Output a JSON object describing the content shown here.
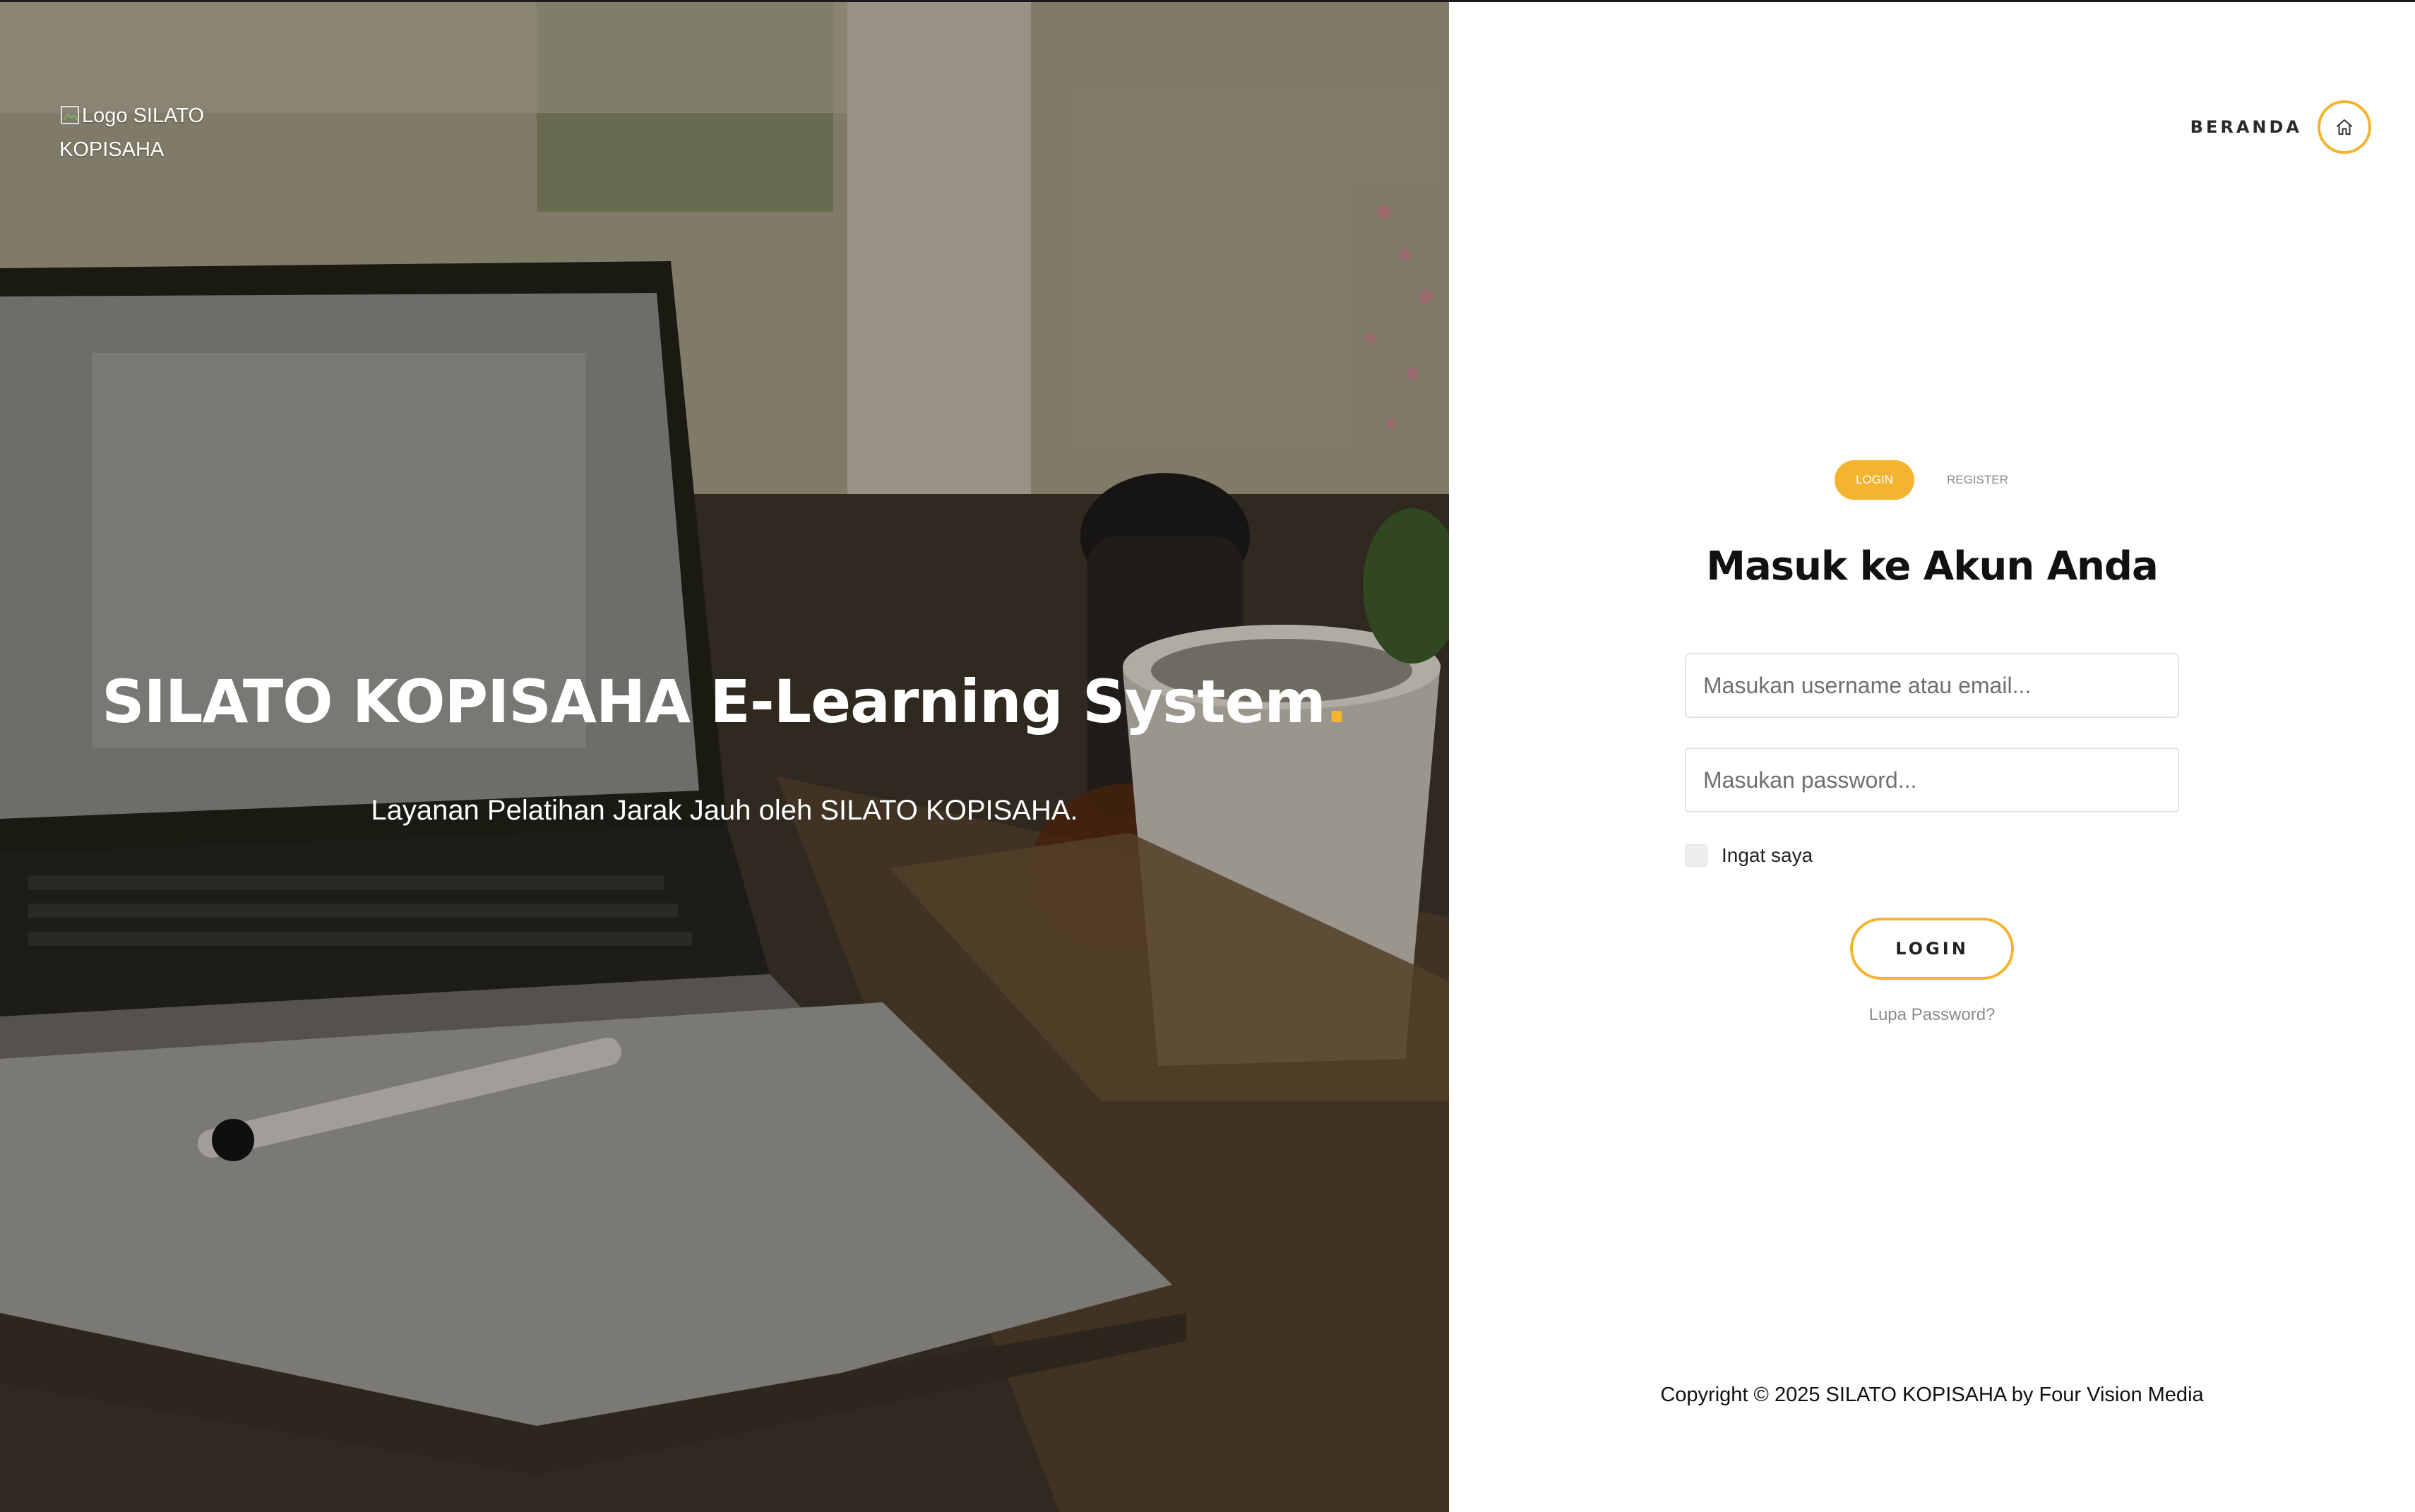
{
  "brand": {
    "logo_alt": "Logo SILATO KOPISAHA"
  },
  "hero": {
    "title": "SILATO KOPISAHA E-Learning System",
    "title_dot": ".",
    "subtitle": "Layanan Pelatihan Jarak Jauh oleh SILATO KOPISAHA."
  },
  "nav": {
    "home_label": "BERANDA"
  },
  "tabs": [
    {
      "label": "LOGIN",
      "active": true
    },
    {
      "label": "REGISTER",
      "active": false
    }
  ],
  "form": {
    "heading": "Masuk ke Akun Anda",
    "username_placeholder": "Masukan username atau email...",
    "password_placeholder": "Masukan password...",
    "remember_label": "Ingat saya",
    "submit_label": "LOGIN",
    "forgot_label": "Lupa Password?"
  },
  "footer": {
    "copyright": "Copyright © 2025 SILATO KOPISAHA by Four Vision Media"
  },
  "colors": {
    "accent": "#f4b430"
  }
}
